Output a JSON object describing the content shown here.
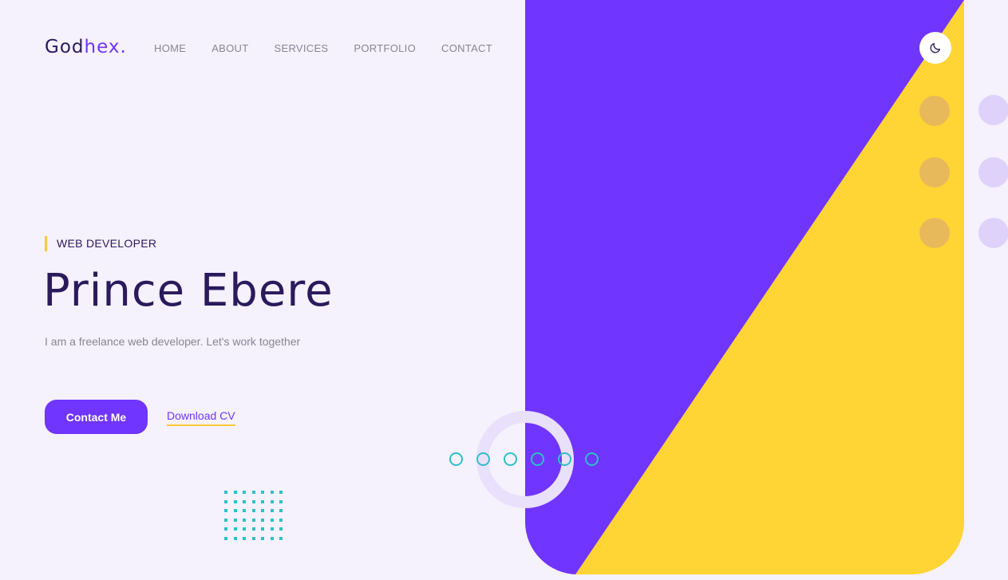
{
  "logo": {
    "part1": "God",
    "part2": "hex",
    "dot": "."
  },
  "nav": {
    "items": [
      "HOME",
      "ABOUT",
      "SERVICES",
      "PORTFOLIO",
      "CONTACT"
    ]
  },
  "theme_toggle": {
    "icon": "moon-icon"
  },
  "hero": {
    "role": "WEB DEVELOPER",
    "name": "Prince Ebere",
    "tagline": "I am a freelance web developer. Let's work together",
    "primary_button": "Contact Me",
    "secondary_link": "Download CV"
  },
  "colors": {
    "background": "#f5f1fd",
    "primary": "#7035ff",
    "accent_yellow": "#ffd435",
    "dark_text": "#2b1a5c",
    "teal": "#2fc0c8"
  }
}
